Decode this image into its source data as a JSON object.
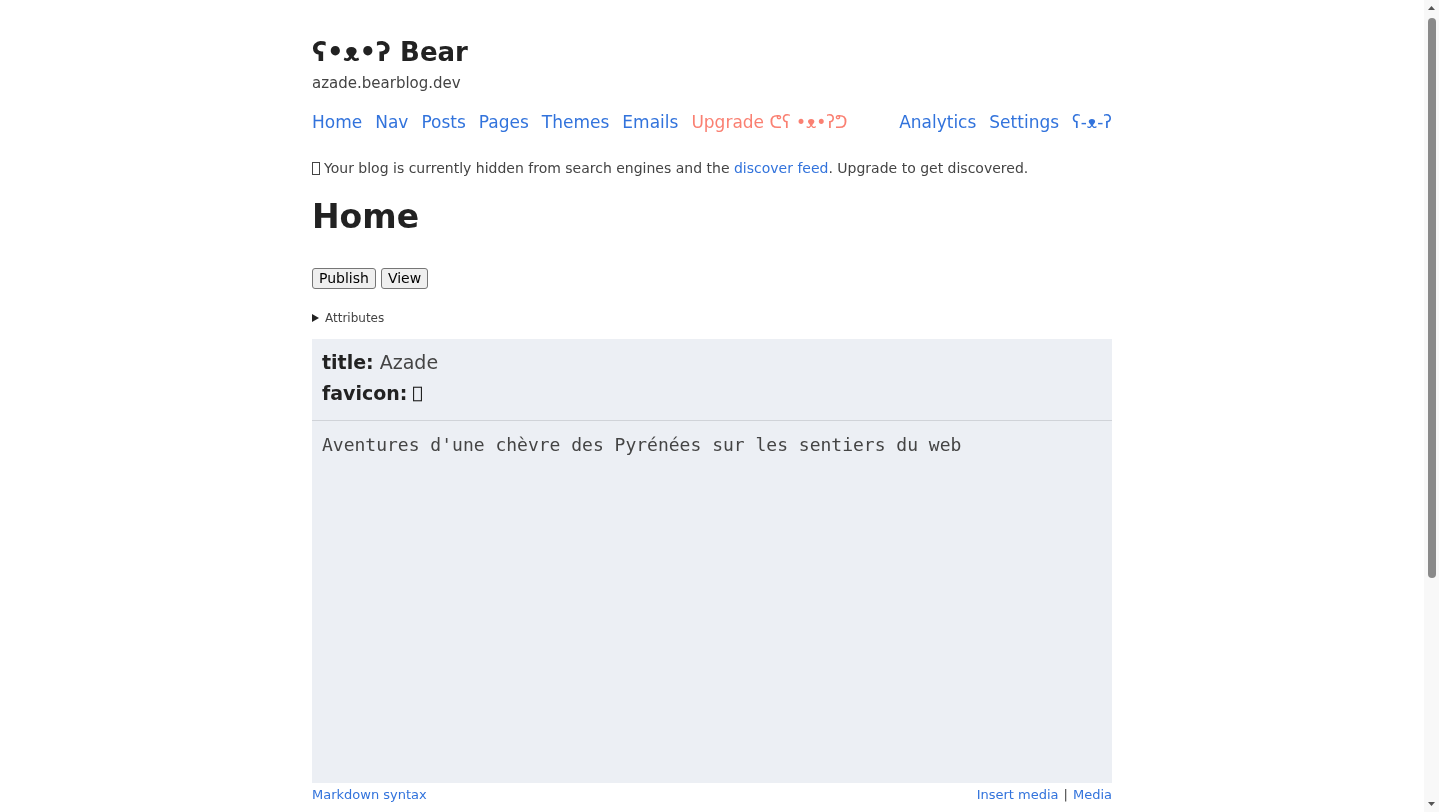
{
  "header": {
    "title": "ʕ•ᴥ•ʔ Bear",
    "subtitle": "azade.bearblog.dev"
  },
  "nav": {
    "left": [
      {
        "label": "Home",
        "kind": "link"
      },
      {
        "label": "Nav",
        "kind": "link"
      },
      {
        "label": "Posts",
        "kind": "link"
      },
      {
        "label": "Pages",
        "kind": "link"
      },
      {
        "label": "Themes",
        "kind": "link"
      },
      {
        "label": "Emails",
        "kind": "link"
      },
      {
        "label": "Upgrade ᕦʕ •ᴥ•ʔᕤ",
        "kind": "upgrade"
      }
    ],
    "right": [
      {
        "label": "Analytics",
        "kind": "link"
      },
      {
        "label": "Settings",
        "kind": "link"
      },
      {
        "label": "ʕ-ᴥ-ʔ",
        "kind": "link"
      }
    ]
  },
  "notice": {
    "before": "Your blog is currently hidden from search engines and the ",
    "link": "discover feed",
    "after": ". Upgrade to get discovered."
  },
  "page": {
    "heading": "Home",
    "buttons": [
      "Publish",
      "View"
    ],
    "attributes": {
      "label": "Attributes",
      "expanded": false
    }
  },
  "editor": {
    "header_lines": [
      {
        "kind": "text",
        "line": "**title:** Azade"
      },
      {
        "kind": "glyph",
        "line": "**favicon:**"
      }
    ],
    "body": "Aventures d'une chèvre des Pyrénées sur les sentiers du web"
  },
  "footer": {
    "left": "Markdown syntax",
    "right": [
      {
        "kind": "link",
        "label": "Insert media"
      },
      {
        "kind": "separator",
        "label": "|"
      },
      {
        "kind": "link",
        "label": "Media"
      }
    ]
  }
}
